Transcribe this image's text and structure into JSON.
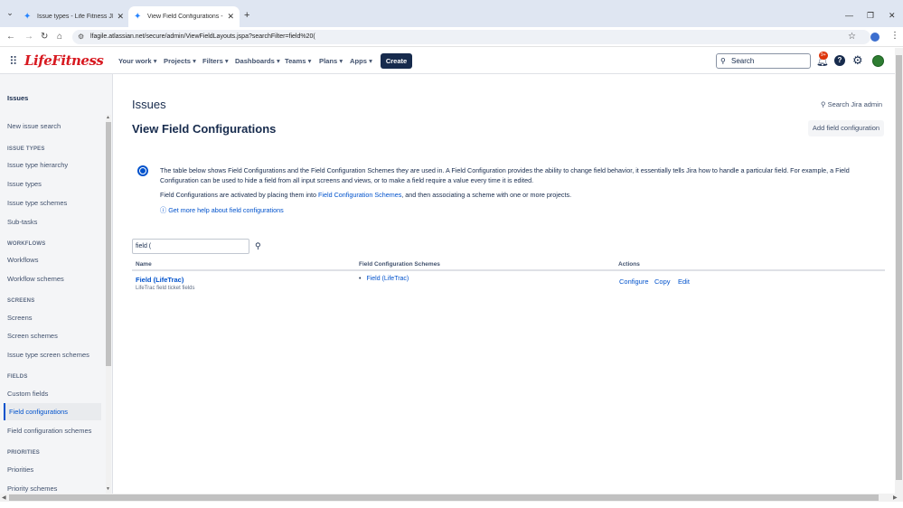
{
  "browser": {
    "tabs": [
      {
        "title": "Issue types - Life Fitness JIRA",
        "active": false
      },
      {
        "title": "View Field Configurations - Life",
        "active": true
      }
    ],
    "url": "lfagile.atlassian.net/secure/admin/ViewFieldLayouts.jspa?searchFilter=field%20("
  },
  "topnav": {
    "logo": "LifeFitness",
    "menus": [
      "Your work",
      "Projects",
      "Filters",
      "Dashboards",
      "Teams",
      "Plans",
      "Apps"
    ],
    "create": "Create",
    "search_placeholder": "Search",
    "notif_badge": "9+"
  },
  "sidebar": {
    "title": "Issues",
    "items": [
      {
        "type": "item",
        "label": "New issue search"
      },
      {
        "type": "head",
        "label": "ISSUE TYPES"
      },
      {
        "type": "item",
        "label": "Issue type hierarchy"
      },
      {
        "type": "item",
        "label": "Issue types"
      },
      {
        "type": "item",
        "label": "Issue type schemes"
      },
      {
        "type": "item",
        "label": "Sub-tasks"
      },
      {
        "type": "head",
        "label": "WORKFLOWS"
      },
      {
        "type": "item",
        "label": "Workflows"
      },
      {
        "type": "item",
        "label": "Workflow schemes"
      },
      {
        "type": "head",
        "label": "SCREENS"
      },
      {
        "type": "item",
        "label": "Screens"
      },
      {
        "type": "item",
        "label": "Screen schemes"
      },
      {
        "type": "item",
        "label": "Issue type screen schemes"
      },
      {
        "type": "head",
        "label": "FIELDS"
      },
      {
        "type": "item",
        "label": "Custom fields"
      },
      {
        "type": "active",
        "label": "Field configurations"
      },
      {
        "type": "item",
        "label": "Field configuration schemes"
      },
      {
        "type": "head",
        "label": "PRIORITIES"
      },
      {
        "type": "item",
        "label": "Priorities"
      },
      {
        "type": "item",
        "label": "Priority schemes"
      }
    ]
  },
  "main": {
    "section": "Issues",
    "title": "View Field Configurations",
    "search_admin": "Search Jira admin",
    "add_button": "Add field configuration",
    "info_para1": "The table below shows Field Configurations and the Field Configuration Schemes they are used in. A Field Configuration provides the ability to change field behavior, it essentially tells Jira how to handle a particular field. For example, a Field Configuration can be used to hide a field from all input screens and views, or to make a field require a value every time it is edited.",
    "info_para2_a": "Field Configurations are activated by placing them into ",
    "info_para2_link": "Field Configuration Schemes",
    "info_para2_b": ", and then associating a scheme with one or more projects.",
    "help_link": "Get more help about field configurations",
    "filter_value": "field (",
    "columns": {
      "name": "Name",
      "schemes": "Field Configuration Schemes",
      "actions": "Actions"
    },
    "rows": [
      {
        "name": "Field (LifeTrac)",
        "description": "LifeTrac field ticket fields",
        "scheme": "Field (LifeTrac)",
        "actions": [
          "Configure",
          "Copy",
          "Edit"
        ]
      }
    ]
  }
}
